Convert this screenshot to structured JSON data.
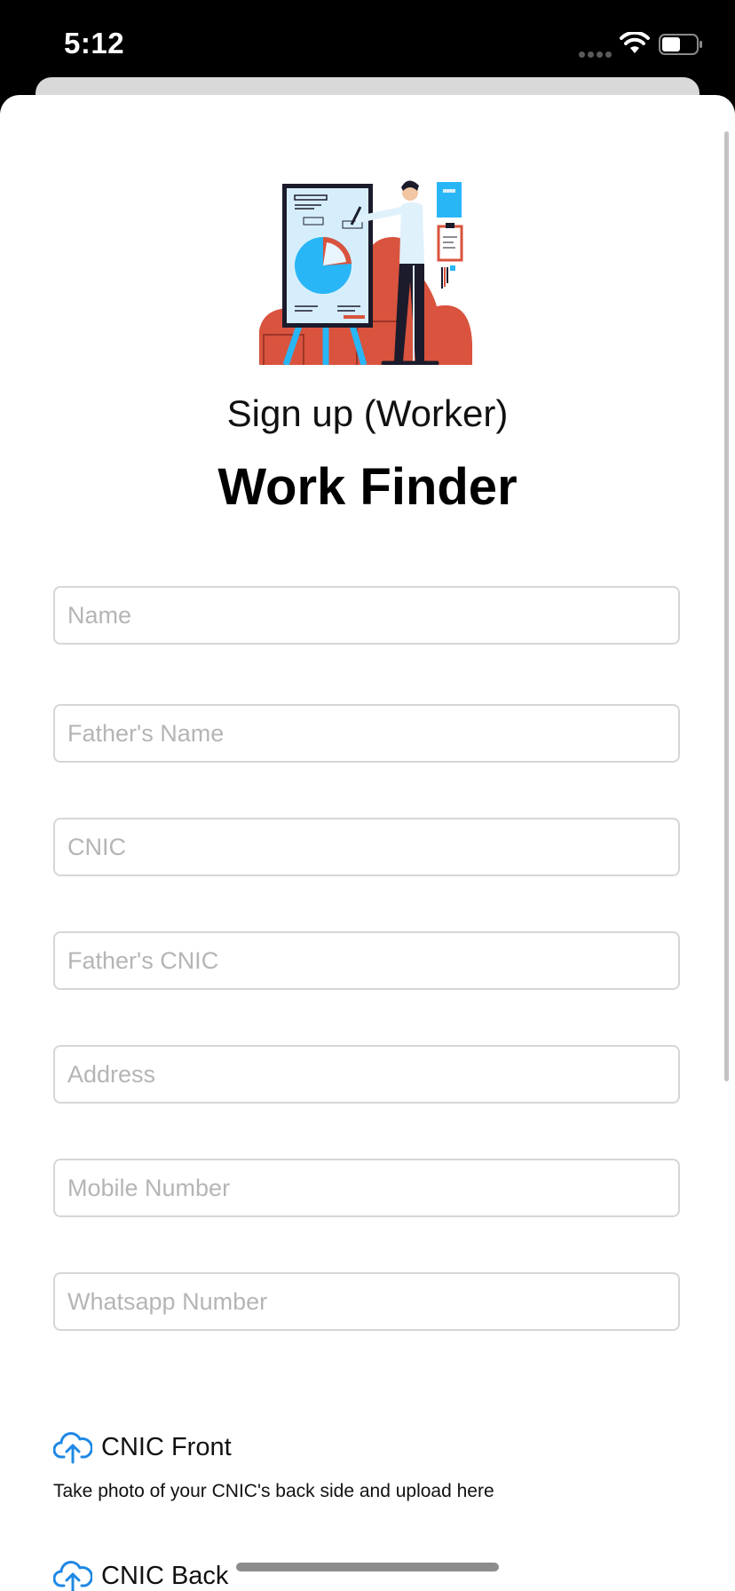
{
  "status_bar": {
    "time": "5:12"
  },
  "header": {
    "subtitle": "Sign up (Worker)",
    "title": "Work Finder"
  },
  "form": {
    "name_placeholder": "Name",
    "father_name_placeholder": "Father's Name",
    "cnic_placeholder": "CNIC",
    "father_cnic_placeholder": "Father's CNIC",
    "address_placeholder": "Address",
    "mobile_placeholder": "Mobile Number",
    "whatsapp_placeholder": "Whatsapp Number"
  },
  "uploads": {
    "front_label": "CNIC Front",
    "front_help": "Take photo of your CNIC's back side and upload here",
    "back_label": "CNIC Back"
  },
  "colors": {
    "accent": "#1E88E5",
    "illustration_red": "#D9533E",
    "illustration_blue": "#29B6F6"
  },
  "icons": {
    "upload": "cloud-upload-icon"
  }
}
